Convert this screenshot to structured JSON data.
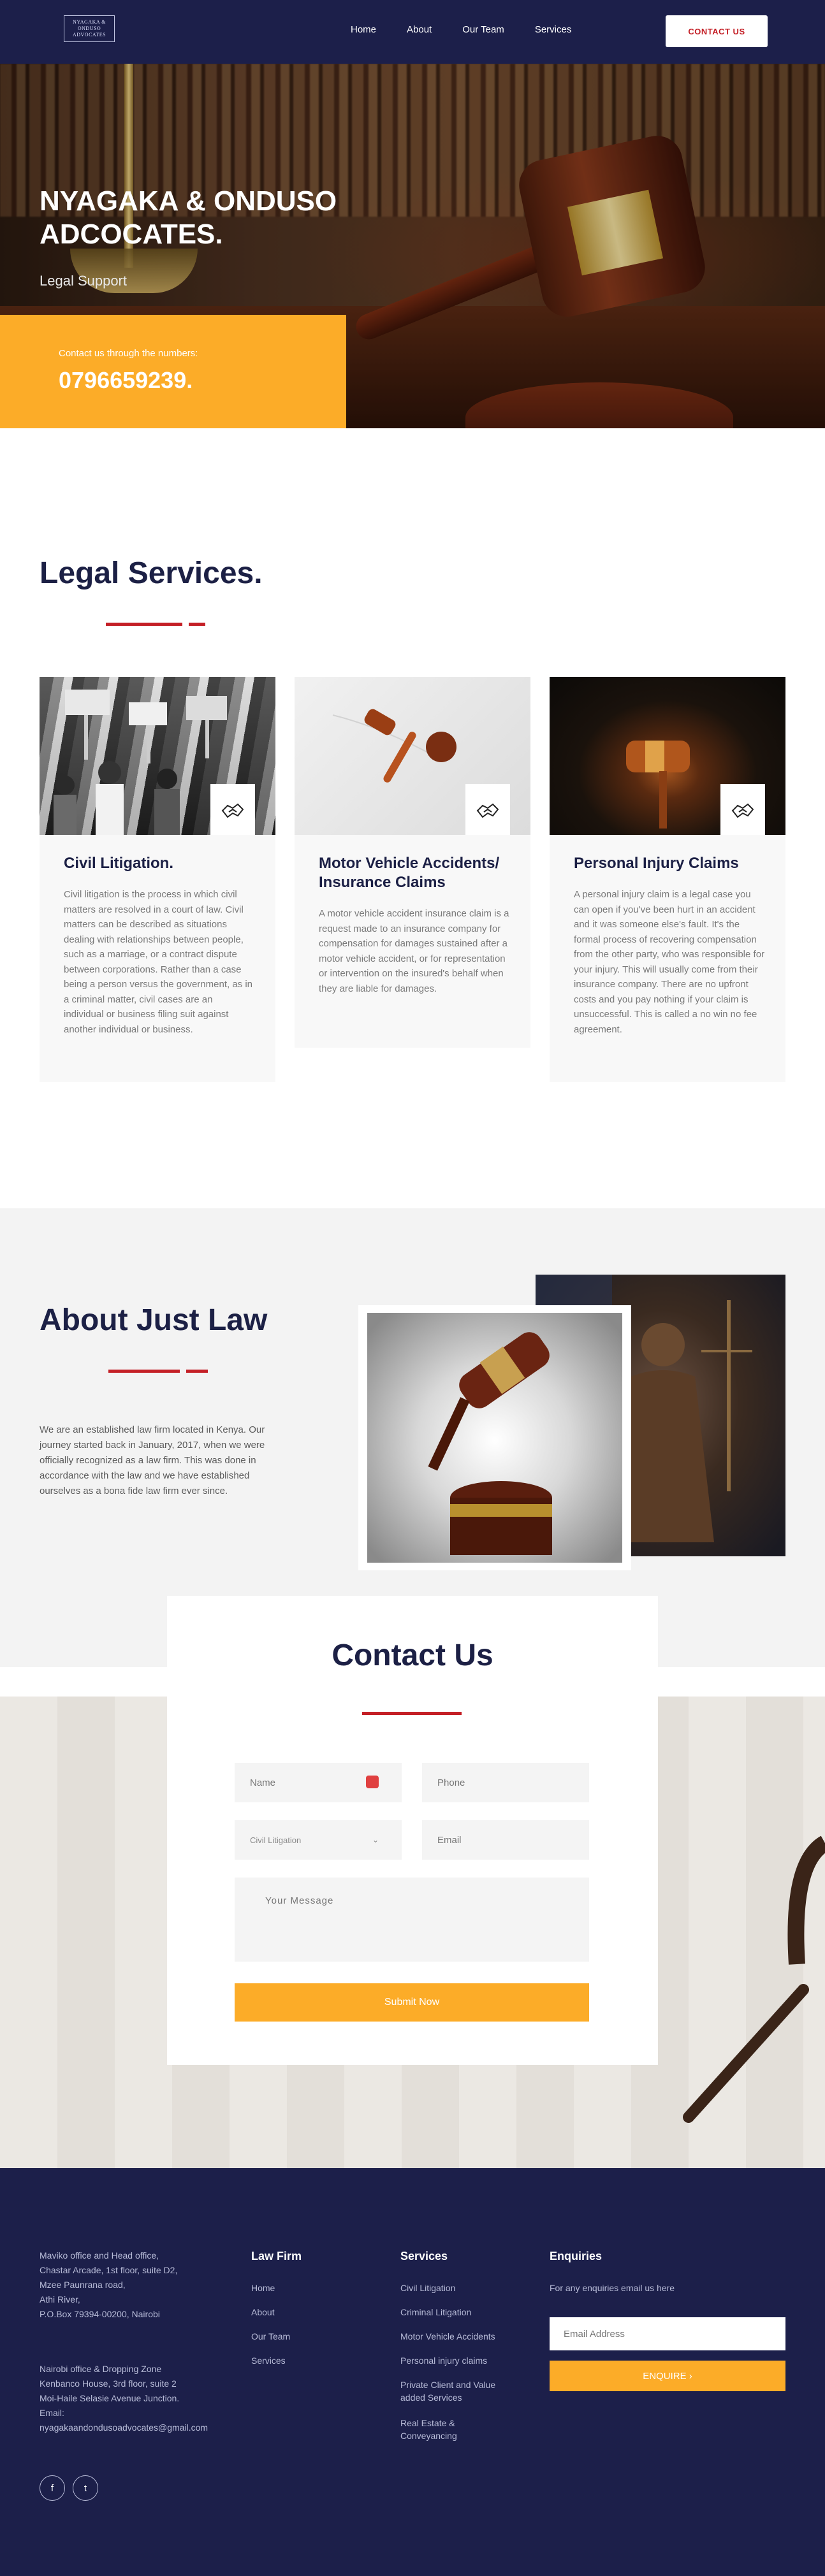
{
  "header": {
    "logo_lines": [
      "NYAGAKA &",
      "ONDUSO",
      "ADVOCATES"
    ],
    "nav": [
      "Home",
      "About",
      "Our Team",
      "Services"
    ],
    "cta": "CONTACT US"
  },
  "hero": {
    "title": "NYAGAKA & ONDUSO ADCOCATES.",
    "subtitle": "Legal Support",
    "contact_label": "Contact us through the numbers:",
    "phone": "0796659239."
  },
  "services": {
    "title": "Legal Services.",
    "cards": [
      {
        "title": "Civil Litigation.",
        "text": "Civil litigation is the process in which civil matters are resolved in a court of law. Civil matters can be described as situations dealing with relationships between people, such as a marriage, or a contract dispute between corporations. Rather than a case being a person versus the government, as in a criminal matter, civil cases are an individual or business filing suit against another individual or business."
      },
      {
        "title": "Motor Vehicle Accidents/ Insurance Claims",
        "text": "A motor vehicle accident insurance claim is a request made to an insurance company for compensation for damages sustained after a motor vehicle accident, or for representation or intervention on the insured's behalf when they are liable for damages."
      },
      {
        "title": "Personal Injury Claims",
        "text": "A personal injury claim is a legal case you can open if you've been hurt in an accident and it was someone else's fault. It's the formal process of recovering compensation from the other party, who was responsible for your injury. This will usually come from their insurance company. There are no upfront costs and you pay nothing if your claim is unsuccessful. This is called a no win no fee agreement."
      }
    ]
  },
  "about": {
    "title": "About Just Law",
    "text": "We are an established law firm located in Kenya. Our journey started back in January, 2017, when we were officially recognized as a law firm. This was done in accordance with the law and we have established ourselves as a bona fide law firm ever since."
  },
  "contact": {
    "title": "Contact Us",
    "name_placeholder": "Name",
    "phone_placeholder": "Phone",
    "service_selected": "Civil Litigation",
    "email_placeholder": "Email",
    "message_placeholder": "Your Message",
    "submit": "Submit Now"
  },
  "footer": {
    "office1": [
      "Maviko office and Head office,",
      "Chastar Arcade, 1st floor, suite D2,",
      "Mzee Paunrana road,",
      "Athi River,",
      "P.O.Box 79394-00200, Nairobi"
    ],
    "office2": [
      "Nairobi office & Dropping Zone",
      "Kenbanco House, 3rd floor, suite 2",
      "Moi-Haile Selasie Avenue Junction.",
      "Email:",
      "nyagakaandondusoadvocates@gmail.com"
    ],
    "lawfirm_title": "Law Firm",
    "lawfirm_links": [
      "Home",
      "About",
      "Our Team",
      "Services"
    ],
    "services_title": "Services",
    "services_links": [
      "Civil Litigation",
      "Criminal Litigation",
      "Motor Vehicle Accidents",
      "Personal injury claims",
      "Private Client and Value added Services",
      "Real Estate & Conveyancing"
    ],
    "enquiries_title": "Enquiries",
    "enquiries_text": "For any enquiries email us here",
    "email_placeholder": "Email Address",
    "enquire_btn": "ENQUIRE  ›",
    "social": [
      "f",
      "t"
    ]
  },
  "colors": {
    "navy": "#1c1f4a",
    "accent": "#fcac28",
    "red": "#c41f26"
  }
}
